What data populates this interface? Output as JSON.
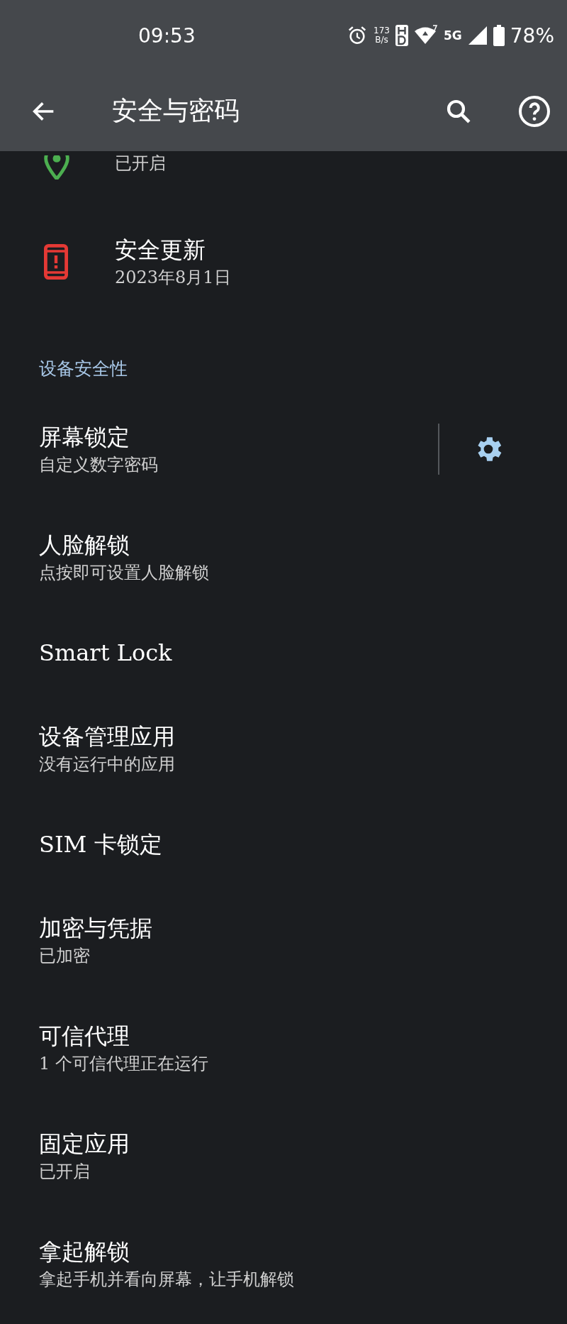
{
  "status_bar": {
    "time": "09:53",
    "net_speed": "173",
    "net_speed_unit": "B/s",
    "network": "5G",
    "battery": "78%"
  },
  "app_bar": {
    "title": "安全与密码"
  },
  "items": [
    {
      "kind": "partial",
      "subtitle": "已开启"
    },
    {
      "kind": "icon",
      "title": "安全更新",
      "subtitle": "2023年8月1日"
    },
    {
      "kind": "header",
      "title": "设备安全性"
    },
    {
      "kind": "gear",
      "title": "屏幕锁定",
      "subtitle": "自定义数字密码"
    },
    {
      "kind": "plain",
      "title": "人脸解锁",
      "subtitle": "点按即可设置人脸解锁"
    },
    {
      "kind": "plain",
      "title": "Smart Lock"
    },
    {
      "kind": "plain",
      "title": "设备管理应用",
      "subtitle": "没有运行中的应用"
    },
    {
      "kind": "plain",
      "title": "SIM 卡锁定"
    },
    {
      "kind": "plain",
      "title": "加密与凭据",
      "subtitle": "已加密"
    },
    {
      "kind": "plain",
      "title": "可信代理",
      "subtitle": "1 个可信代理正在运行"
    },
    {
      "kind": "plain",
      "title": "固定应用",
      "subtitle": "已开启"
    },
    {
      "kind": "plain",
      "title": "拿起解锁",
      "subtitle": "拿起手机并看向屏幕，让手机解锁"
    }
  ]
}
